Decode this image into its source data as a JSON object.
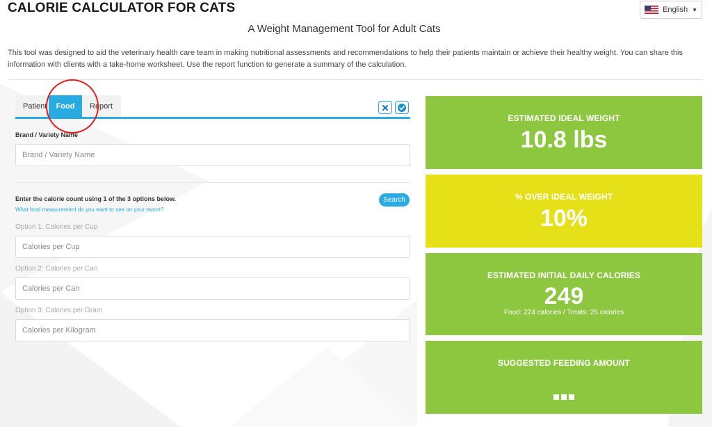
{
  "header": {
    "title": "CALORIE CALCULATOR FOR CATS",
    "subtitle": "A Weight Management Tool for Adult Cats",
    "language": "English",
    "language_icon": "us-flag-icon"
  },
  "intro": {
    "line1": "This tool was designed to aid the veterinary health care team in making nutritional assessments and recommendations to help their patients maintain or achieve their healthy weight. You can share this",
    "line2": "information with clients with a take-home worksheet. Use the report function to generate a summary of the calculation."
  },
  "tabs": [
    {
      "label": "Patient",
      "active": false
    },
    {
      "label": "Food",
      "active": true
    },
    {
      "label": "Report",
      "active": false
    }
  ],
  "toolbar": {
    "clear_icon": "close-icon",
    "confirm_icon": "check-icon"
  },
  "form": {
    "brand_label": "Brand / Variety Name",
    "brand_placeholder": "Brand / Variety Name",
    "instructions": "Enter the calorie count using 1 of the 3 options below.",
    "hint_link": "What food measurement do you want to see on your report?",
    "search_label": "Search",
    "options": [
      {
        "label": "Option 1: Calories per Cup",
        "placeholder": "Calories per Cup"
      },
      {
        "label": "Option 2: Calories per Can",
        "placeholder": "Calories per Can"
      },
      {
        "label": "Option 3: Calories per Gram",
        "placeholder": "Calories per Kilogram"
      }
    ]
  },
  "results": {
    "ideal_weight": {
      "heading": "ESTIMATED IDEAL WEIGHT",
      "value": "10.8 lbs"
    },
    "over_weight": {
      "heading": "% OVER IDEAL WEIGHT",
      "value": "10%"
    },
    "daily_calories": {
      "heading": "ESTIMATED INITIAL DAILY CALORIES",
      "value": "249",
      "breakdown": "Food: 224 calories / Treats: 25 calories"
    },
    "feeding_amount": {
      "heading": "SUGGESTED FEEDING AMOUNT",
      "value_icon": "ellipsis-icon"
    }
  },
  "colors": {
    "accent": "#29aae1",
    "card_green": "#8dc63f",
    "card_yellow": "#e6e019",
    "highlight_circle": "#e02020"
  }
}
